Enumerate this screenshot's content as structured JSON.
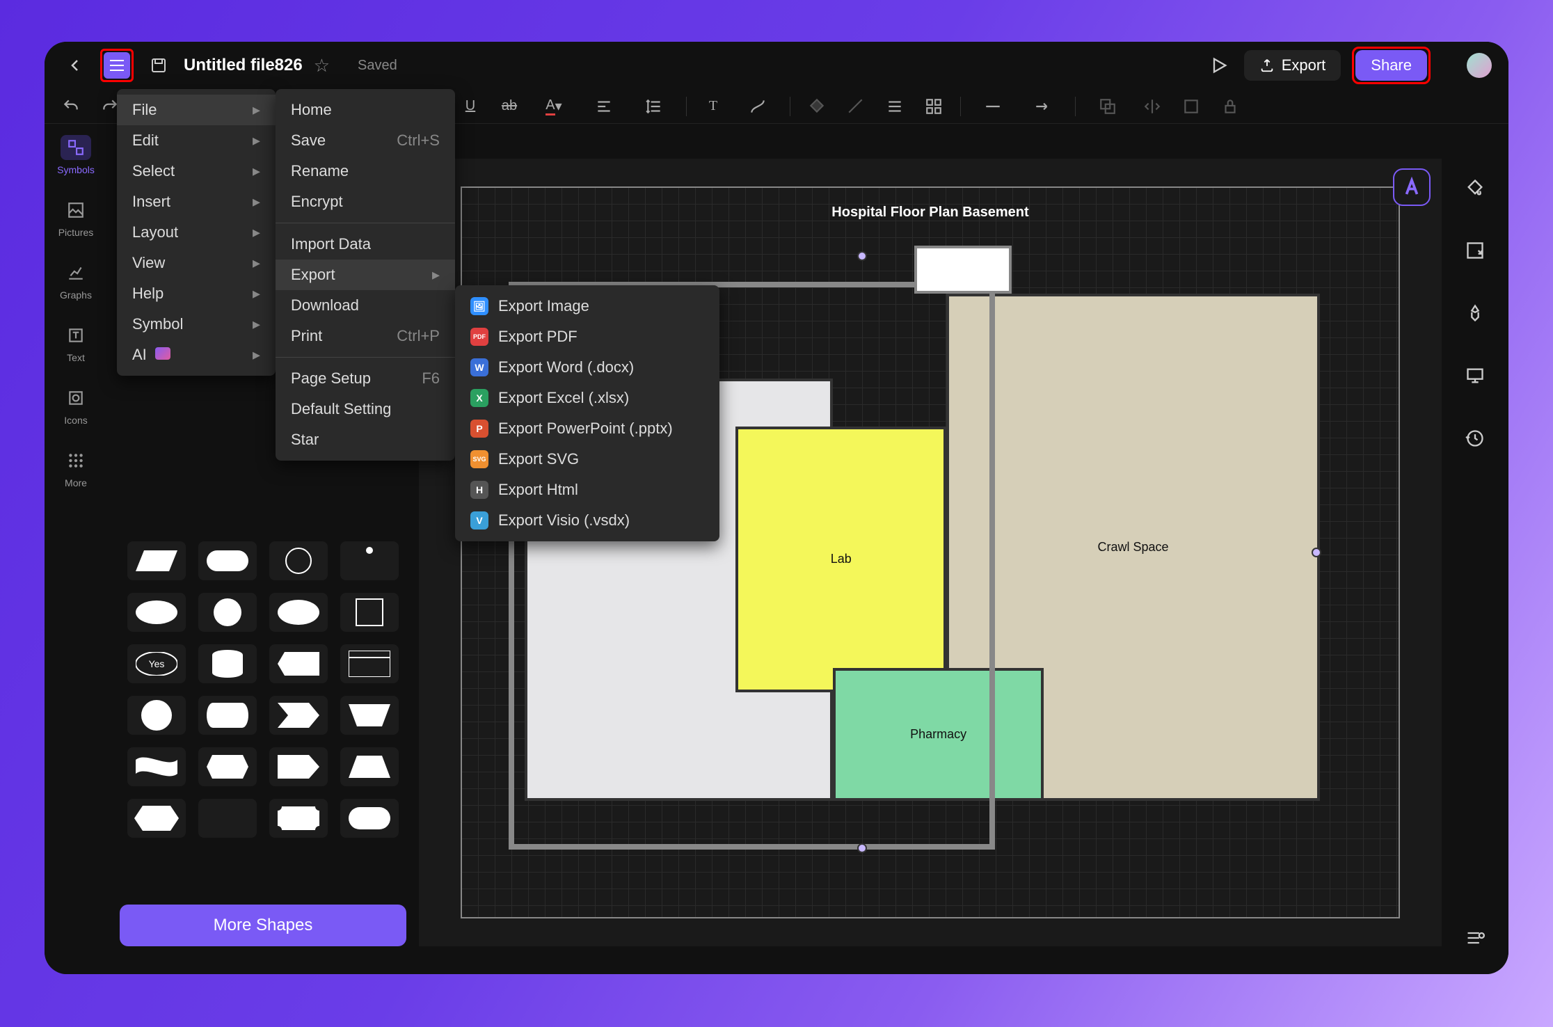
{
  "header": {
    "filename": "Untitled file826",
    "saved_label": "Saved",
    "export_label": "Export",
    "share_label": "Share"
  },
  "left_strip": [
    {
      "icon": "symbols",
      "label": "Symbols",
      "active": true
    },
    {
      "icon": "pictures",
      "label": "Pictures"
    },
    {
      "icon": "graphs",
      "label": "Graphs"
    },
    {
      "icon": "text",
      "label": "Text"
    },
    {
      "icon": "icons",
      "label": "Icons"
    },
    {
      "icon": "more",
      "label": "More"
    }
  ],
  "more_shapes_label": "More Shapes",
  "main_menu": [
    {
      "label": "File",
      "has_sub": true,
      "hover": true
    },
    {
      "label": "Edit",
      "has_sub": true
    },
    {
      "label": "Select",
      "has_sub": true
    },
    {
      "label": "Insert",
      "has_sub": true
    },
    {
      "label": "Layout",
      "has_sub": true
    },
    {
      "label": "View",
      "has_sub": true
    },
    {
      "label": "Help",
      "has_sub": true
    },
    {
      "label": "Symbol",
      "has_sub": true
    },
    {
      "label": "AI",
      "has_sub": true,
      "ai": true
    }
  ],
  "file_menu": [
    {
      "label": "Home"
    },
    {
      "label": "Save",
      "shortcut": "Ctrl+S"
    },
    {
      "label": "Rename"
    },
    {
      "label": "Encrypt"
    },
    {
      "sep": true
    },
    {
      "label": "Import Data"
    },
    {
      "label": "Export",
      "has_sub": true,
      "hover": true
    },
    {
      "label": "Download"
    },
    {
      "label": "Print",
      "shortcut": "Ctrl+P"
    },
    {
      "sep": true
    },
    {
      "label": "Page Setup",
      "shortcut": "F6"
    },
    {
      "label": "Default Setting"
    },
    {
      "label": "Star"
    }
  ],
  "export_menu": [
    {
      "icon_bg": "#2f8fff",
      "icon_txt": "🖼",
      "label": "Export Image"
    },
    {
      "icon_bg": "#e04040",
      "icon_txt": "PDF",
      "label": "Export PDF"
    },
    {
      "icon_bg": "#3a6fd8",
      "icon_txt": "W",
      "label": "Export Word (.docx)"
    },
    {
      "icon_bg": "#2aa060",
      "icon_txt": "X",
      "label": "Export Excel (.xlsx)"
    },
    {
      "icon_bg": "#d85030",
      "icon_txt": "P",
      "label": "Export PowerPoint (.pptx)"
    },
    {
      "icon_bg": "#f09030",
      "icon_txt": "SVG",
      "label": "Export SVG"
    },
    {
      "icon_bg": "#555",
      "icon_txt": "H",
      "label": "Export Html"
    },
    {
      "icon_bg": "#3a9fd8",
      "icon_txt": "V",
      "label": "Export Visio (.vsdx)"
    }
  ],
  "canvas": {
    "title": "Hospital Floor Plan Basement",
    "rooms": {
      "crawl_space": "Crawl Space",
      "lab": "Lab",
      "pharmacy": "Pharmacy"
    }
  },
  "shape_yes_label": "Yes"
}
